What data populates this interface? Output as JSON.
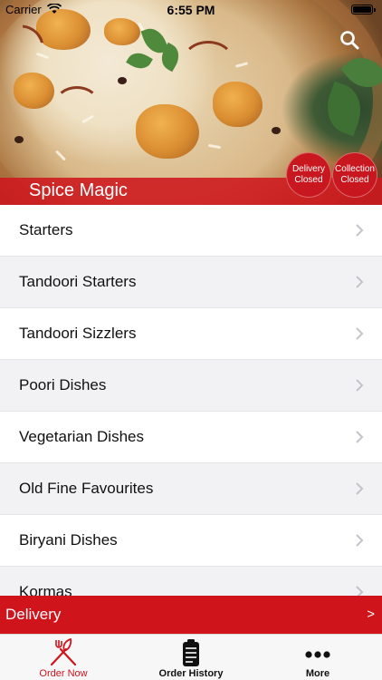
{
  "status_bar": {
    "carrier": "Carrier",
    "time": "6:55 PM"
  },
  "restaurant": {
    "name": "Spice Magic"
  },
  "status_badges": {
    "delivery": {
      "line1": "Delivery",
      "line2": "Closed"
    },
    "collection": {
      "line1": "Collection",
      "line2": "Closed"
    }
  },
  "menu": {
    "categories": [
      "Starters",
      "Tandoori Starters",
      "Tandoori Sizzlers",
      "Poori Dishes",
      "Vegetarian Dishes",
      "Old Fine Favourites",
      "Biryani Dishes",
      "Kormas"
    ]
  },
  "delivery_bar": {
    "label": "Delivery",
    "arrow": ">"
  },
  "tabs": [
    {
      "label": "Order Now",
      "icon": "fork-knife-icon"
    },
    {
      "label": "Order History",
      "icon": "receipt-icon"
    },
    {
      "label": "More",
      "icon": "more-dots-icon"
    }
  ],
  "colors": {
    "brand_red": "#d0141c",
    "active_tab": "#d0141c"
  }
}
